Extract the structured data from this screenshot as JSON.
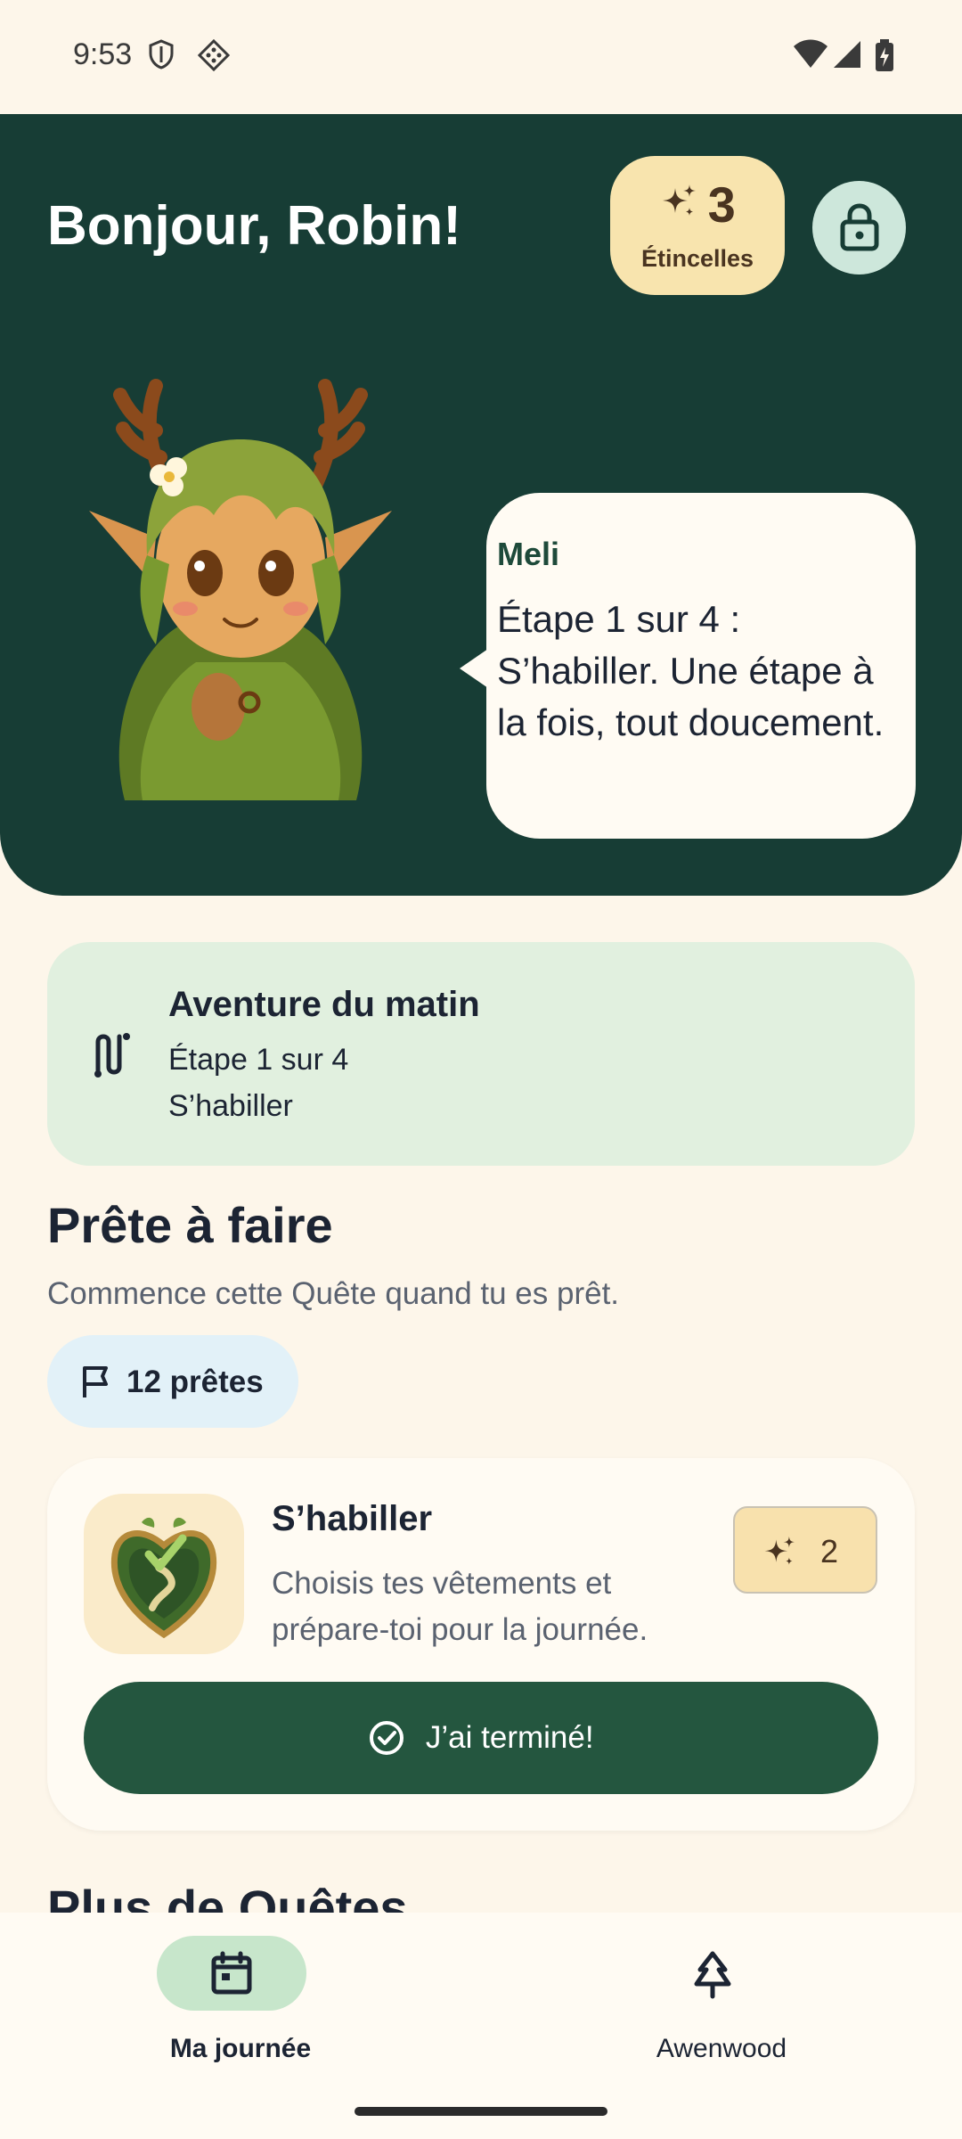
{
  "status_bar": {
    "time": "9:53",
    "icons": [
      "shield-icon",
      "diamond-dots-icon",
      "wifi-icon",
      "signal-icon",
      "battery-charging-icon"
    ]
  },
  "header": {
    "greeting": "Bonjour, Robin!",
    "sparks": {
      "count": "3",
      "label": "Étincelles",
      "icon": "sparkle-icon"
    },
    "lock_icon": "lock-icon"
  },
  "mascot": {
    "speaker": "Meli",
    "message": "Étape 1 sur 4 : S’habiller. Une étape à la fois, tout doucement."
  },
  "adventure": {
    "icon": "route-icon",
    "title": "Aventure du matin",
    "step": "Étape 1 sur 4",
    "subtitle": "S’habiller"
  },
  "ready_section": {
    "title": "Prête à faire",
    "subtitle": "Commence cette Quête quand tu es prêt.",
    "chip_label": "12 prêtes",
    "chip_icon": "flag-icon"
  },
  "quest": {
    "title": "S’habiller",
    "description": "Choisis tes vêtements et prépare-toi pour la journée.",
    "reward": "2",
    "done_label": "J’ai terminé!"
  },
  "more_section": {
    "title": "Plus de Quêtes"
  },
  "bottom_nav": [
    {
      "label": "Ma journée",
      "icon": "calendar-icon",
      "active": true
    },
    {
      "label": "Awenwood",
      "icon": "tree-icon",
      "active": false
    }
  ],
  "colors": {
    "background": "#FDF6EA",
    "hero": "#173D35",
    "accent_button": "#24563F",
    "sparks_badge": "#F8E4AE",
    "adventure_card": "#E1F0DF",
    "chip_blue": "#E2F1F8"
  }
}
